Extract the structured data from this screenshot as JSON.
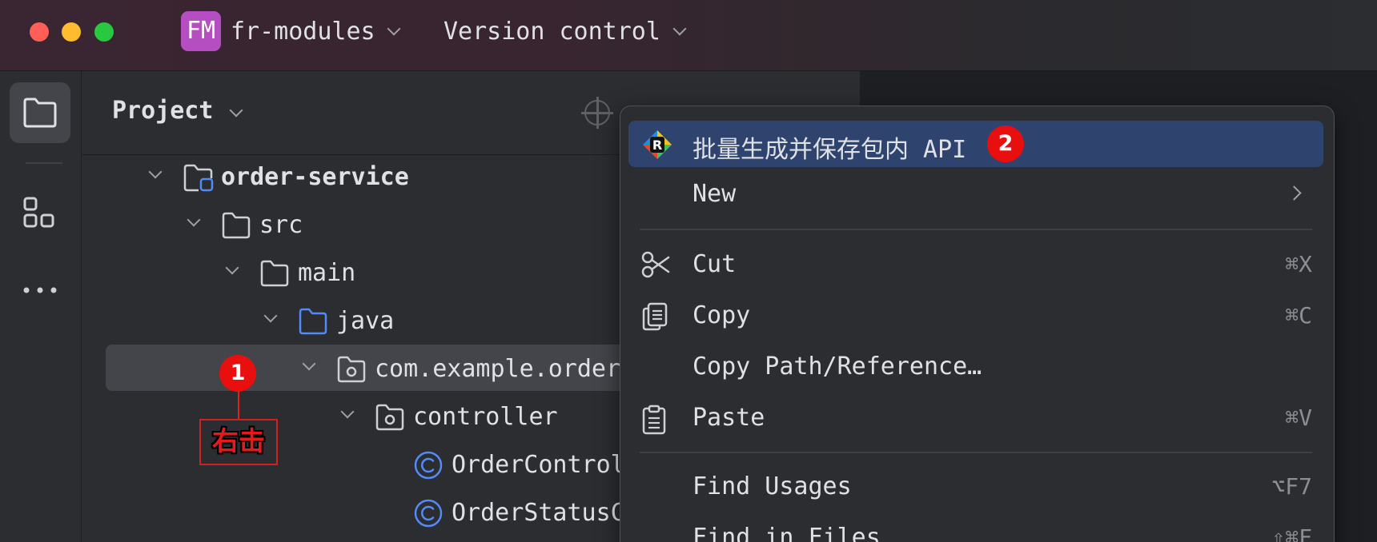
{
  "titlebar": {
    "project_badge": "FM",
    "project_name": "fr-modules",
    "vcs_label": "Version control"
  },
  "panel": {
    "title": "Project"
  },
  "tree": [
    {
      "label": "order-service",
      "icon": "module-folder-icon",
      "bold": true
    },
    {
      "label": "src",
      "icon": "folder-icon"
    },
    {
      "label": "main",
      "icon": "folder-icon"
    },
    {
      "label": "java",
      "icon": "source-folder-icon"
    },
    {
      "label": "com.example.order",
      "icon": "package-icon",
      "selected": true
    },
    {
      "label": "controller",
      "icon": "package-icon"
    },
    {
      "label": "OrderControl",
      "icon": "java-class-icon"
    },
    {
      "label": "OrderStatusC",
      "icon": "java-class-icon"
    }
  ],
  "context_menu": {
    "items": [
      {
        "label": "批量生成并保存包内 API",
        "icon": "plugin-logo-icon",
        "highlighted": true
      },
      {
        "label": "New",
        "submenu": true
      },
      {
        "label": "Cut",
        "icon": "scissors-icon",
        "shortcut": "⌘X"
      },
      {
        "label": "Copy",
        "icon": "copy-icon",
        "shortcut": "⌘C"
      },
      {
        "label": "Copy Path/Reference…"
      },
      {
        "label": "Paste",
        "icon": "clipboard-icon",
        "shortcut": "⌘V"
      },
      {
        "label": "Find Usages",
        "shortcut": "⌥F7"
      },
      {
        "label": "Find in Files",
        "shortcut": "⇧⌘F"
      }
    ]
  },
  "annotations": {
    "step1_number": "1",
    "step1_text": "右击",
    "step2_number": "2",
    "accent_color": "#ea0f0f"
  },
  "colors": {
    "window_bg": "#1e1f22",
    "panel_bg": "#2b2d30",
    "selection_bg": "#43454a",
    "menu_highlight": "#2e436e",
    "class_icon": "#548af7",
    "traffic_red": "#ff5f57",
    "traffic_yellow": "#febc2e",
    "traffic_green": "#28c840",
    "project_badge": "#b54ec0"
  }
}
